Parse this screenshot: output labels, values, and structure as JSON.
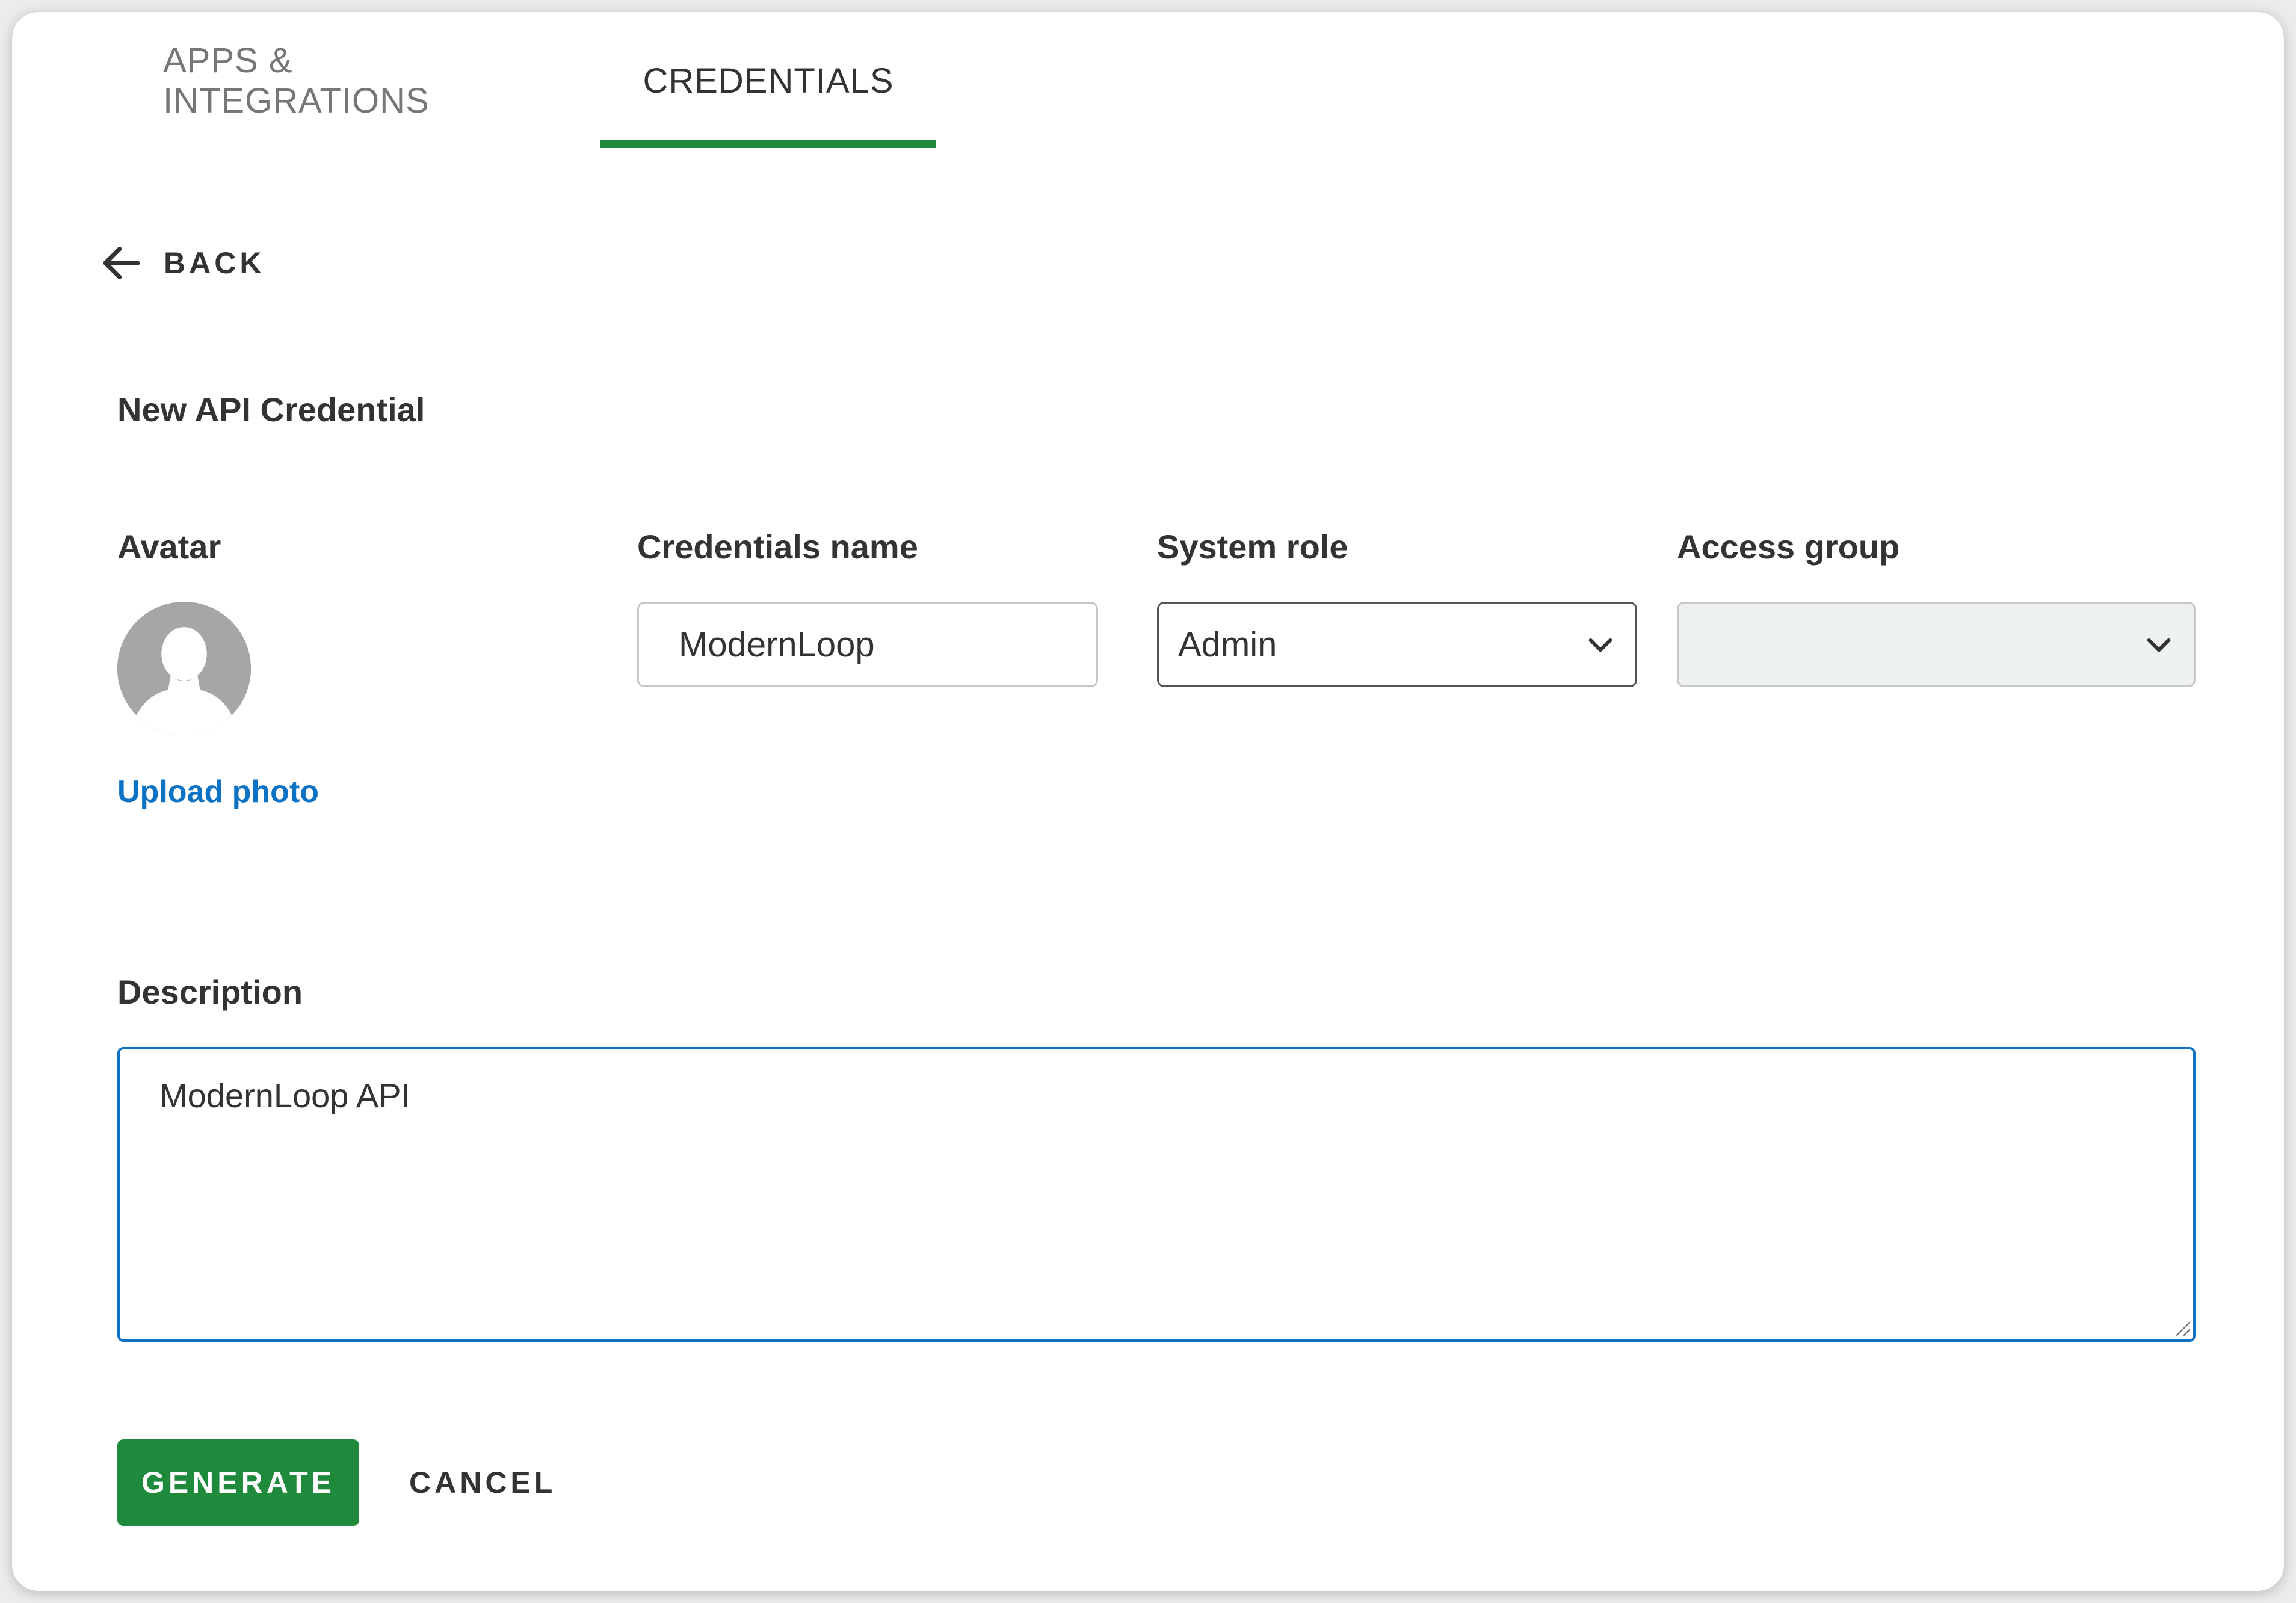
{
  "tabs": [
    {
      "label": "APPS & INTEGRATIONS",
      "active": false
    },
    {
      "label": "CREDENTIALS",
      "active": true
    }
  ],
  "back": {
    "label": "BACK",
    "icon": "arrow-left-icon"
  },
  "page_title": "New API Credential",
  "form": {
    "avatar": {
      "label": "Avatar",
      "upload_label": "Upload photo",
      "icon": "user-silhouette-icon"
    },
    "credentials_name": {
      "label": "Credentials name",
      "value": "ModernLoop"
    },
    "system_role": {
      "label": "System role",
      "value": "Admin",
      "icon": "chevron-down-icon"
    },
    "access_group": {
      "label": "Access group",
      "value": "",
      "icon": "chevron-down-icon"
    },
    "description": {
      "label": "Description",
      "value": "ModernLoop API"
    }
  },
  "actions": {
    "generate_label": "GENERATE",
    "cancel_label": "CANCEL"
  },
  "colors": {
    "accent_green": "#1f8a3b",
    "link_blue": "#0c72c4",
    "text": "#333333",
    "muted_text": "#777777",
    "disabled_field_bg": "#eef2ee"
  }
}
